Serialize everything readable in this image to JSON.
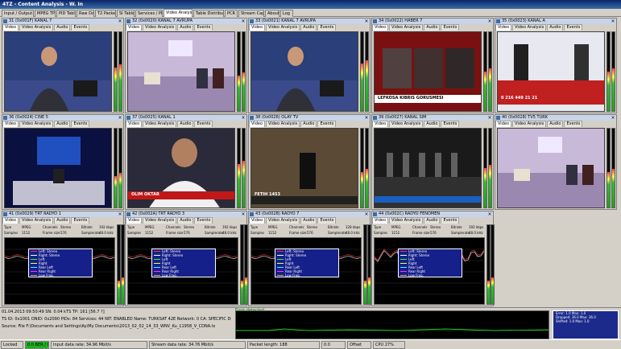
{
  "window": {
    "title": "4TZ - Content Analysis - W. In"
  },
  "tabs": [
    {
      "label": "Input / Output",
      "active": false
    },
    {
      "label": "MPEG TP",
      "active": false
    },
    {
      "label": "PID Table",
      "active": false
    },
    {
      "label": "Raw Data",
      "active": false
    },
    {
      "label": "T2 Packets",
      "active": false
    },
    {
      "label": "SI Tables",
      "active": false
    },
    {
      "label": "Services / PIDs",
      "active": false
    },
    {
      "label": "Video Analysis",
      "active": true
    },
    {
      "label": "Table Distribution",
      "active": false
    },
    {
      "label": "PCR",
      "active": false
    },
    {
      "label": "Stream Capture",
      "active": false
    },
    {
      "label": "About",
      "active": false
    },
    {
      "label": "Log",
      "active": false
    }
  ],
  "pane_tabs": [
    "Video",
    "Video Analysis",
    "Audio",
    "Events"
  ],
  "video_panes": [
    {
      "title": "31 (0x001F) KANAL 7",
      "scene": "studio-anchor",
      "bg": "#2b3f7a",
      "meter": 0.55
    },
    {
      "title": "32 (0x0020) KANAL 7 AVRUPA",
      "scene": "talk-show",
      "bg": "#c9b9d8",
      "meter": 0.45
    },
    {
      "title": "33 (0x0021) KANAL 7 AVRUPA",
      "scene": "studio-anchor",
      "bg": "#2b3f7a",
      "meter": 0.6
    },
    {
      "title": "34 (0x0022) HABER 7",
      "scene": "panel",
      "bg": "#7a1010",
      "meter": 0.5,
      "caption": "LEFKOSA KIBRIS GORUSMESI"
    },
    {
      "title": "35 (0x0023) KANAL A",
      "scene": "phone",
      "bg": "#e8e8f0",
      "meter": 0.5,
      "caption": "0 216 449 21 21"
    },
    {
      "title": "36 (0x0024) CINE 5",
      "scene": "news-desk",
      "bg": "#0a1040",
      "meter": 0.4
    },
    {
      "title": "37 (0x0025) KANAL 1",
      "scene": "interview",
      "bg": "#2a2a3a",
      "meter": 0.55,
      "caption": "OLIM OKTAR"
    },
    {
      "title": "38 (0x0026) OLAY TV",
      "scene": "movie",
      "bg": "#3a3024",
      "meter": 0.45,
      "caption": "FETIH 1453"
    },
    {
      "title": "39 (0x0027) KANAL SIM",
      "scene": "stage",
      "bg": "#1a1a1a",
      "meter": 0.5
    },
    {
      "title": "40 (0x0028) TV5 TURK",
      "scene": "talk-show",
      "bg": "#c9b9d8",
      "meter": 0.45
    }
  ],
  "audio_panes": [
    {
      "title": "41 (0x0029) TRT RADYO 1",
      "type": "MPEG",
      "channel": "Stereo",
      "bitrate": "192 kbps",
      "sync": "1152",
      "frame": "576",
      "samplerate": "48.0 kHz"
    },
    {
      "title": "42 (0x002A) TRT RADYO 3",
      "type": "MPEG",
      "channel": "Stereo",
      "bitrate": "192 kbps",
      "sync": "1152",
      "frame": "576",
      "samplerate": "48.0 kHz"
    },
    {
      "title": "43 (0x002B) RADYO 7",
      "type": "MPEG",
      "channel": "Stereo",
      "bitrate": "128 kbps",
      "sync": "1152",
      "frame": "576",
      "samplerate": "48.0 kHz"
    },
    {
      "title": "44 (0x002C) RADYO FENOMEN",
      "type": "MPEG",
      "channel": "Stereo",
      "bitrate": "192 kbps",
      "sync": "1152",
      "frame": "576",
      "samplerate": "48.0 kHz"
    }
  ],
  "audio_labels": {
    "type": "Type",
    "channel": "Channels",
    "bitrate": "Bitrate",
    "sync": "Samples",
    "frame": "Frame size",
    "samplerate": "Samplerate"
  },
  "legend": [
    "Left: Stereo",
    "Right: Stereo",
    "Left",
    "Right",
    "Rear Left",
    "Rear Right",
    "Low Freq."
  ],
  "legend_colors": [
    "#ff3030",
    "#ffffff",
    "#30ff30",
    "#ffff30",
    "#30ffff",
    "#ff30ff",
    "#ff9030"
  ],
  "bottom": {
    "line1": "01.04.2013 09:50:49    SN: 0.04 kTS    TP: 161 [56.7 ?]",
    "line2": "TS ID: 0x1001    ONID: 0x2090    PIDs: 84    Services: 44    NIT: ENABLED    Name: TURKSAT 42E    Network: 0    CA: SPECIFIC    Duration: 00:01:04",
    "line3": "Source: File   F:\\Documents and Settings\\Ay\\My Documents\\2013_02_02_14_33_WNV_Ku_11958_V_CDNA.ts",
    "err_title": "Error detected",
    "err_rows": [
      "Error: 1.0  Max: 1.0",
      "Dropped: 36.0 Max: 36.0",
      "Shifted: 1.0  Max: 1.0"
    ]
  },
  "status": [
    {
      "label": "Locked",
      "green": false
    },
    {
      "label": "0.0 BER / 0.0",
      "green": true
    },
    {
      "label": "Input data rate: 34.96 Mbit/s",
      "green": false
    },
    {
      "label": "Stream data rate: 34.76 Mbit/s",
      "green": false
    },
    {
      "label": "Packet length: 188",
      "green": false
    },
    {
      "label": "0.0",
      "green": false
    },
    {
      "label": "Offset",
      "green": false
    },
    {
      "label": "CPU 27%",
      "green": false
    }
  ]
}
